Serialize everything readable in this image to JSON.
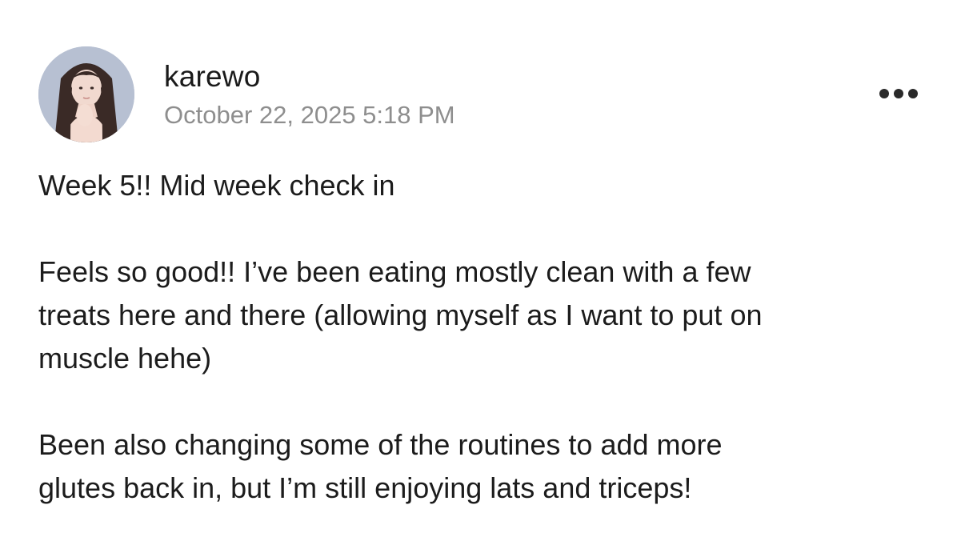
{
  "post": {
    "author": {
      "username": "karewo",
      "avatar_icon": "profile-photo"
    },
    "timestamp": "October 22, 2025 5:18 PM",
    "more_icon": "ellipsis-horizontal-icon",
    "paragraphs": [
      [
        "Week 5!! Mid week check in"
      ],
      [
        "Feels so good!! I’ve been eating mostly clean with a few",
        "treats here and there (allowing myself as I want to put on",
        "muscle hehe)"
      ],
      [
        "Been also changing some of the routines to add more",
        "glutes back in, but I’m still enjoying lats and triceps!"
      ]
    ]
  },
  "colors": {
    "text": "#1c1c1c",
    "timestamp": "#8e8e8e",
    "background": "#ffffff"
  }
}
